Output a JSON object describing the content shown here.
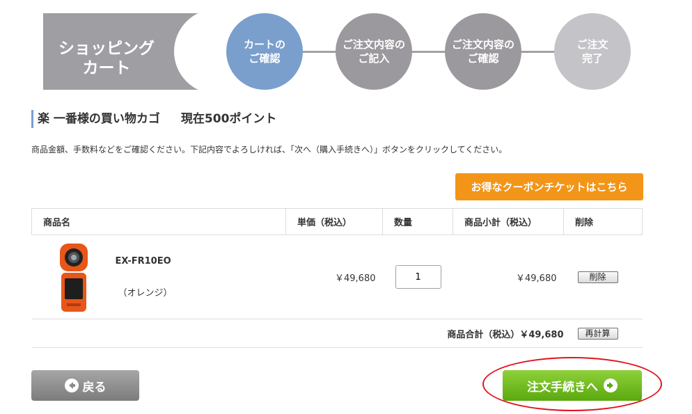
{
  "header": {
    "cart_title_line1": "ショッピング",
    "cart_title_line2": "カート",
    "steps": [
      {
        "label": "カートの\nご確認"
      },
      {
        "label": "ご注文内容の\nご記入"
      },
      {
        "label": "ご注文内容の\nご確認"
      },
      {
        "label": "ご注文\n完了"
      }
    ]
  },
  "shop": {
    "name": "楽 一番様の買い物カゴ",
    "points": "現在500ポイント",
    "notice": "商品金額、手数料などをご確認ください。下記内容でよろしければ、「次へ（購入手続きへ）」ボタンをクリックしてください。",
    "coupon_button": "お得なクーポンチケットはこちら"
  },
  "table": {
    "headers": [
      "商品名",
      "単価（税込）",
      "数量",
      "商品小計（税込）",
      "削除"
    ],
    "items": [
      {
        "name": "EX-FR10EO",
        "variant": "（オレンジ）",
        "unit_price": "￥49,680",
        "quantity": "1",
        "subtotal": "￥49,680",
        "delete_label": "削除"
      }
    ],
    "total_label": "商品合計（税込）￥49,680",
    "recalc_label": "再計算"
  },
  "footer": {
    "back_label": "戻る",
    "next_label": "注文手続きへ"
  },
  "colors": {
    "active_step": "#7a9fcd",
    "coupon": "#f39518",
    "next_button": "#6cbb1c",
    "highlight": "#e0141e"
  }
}
